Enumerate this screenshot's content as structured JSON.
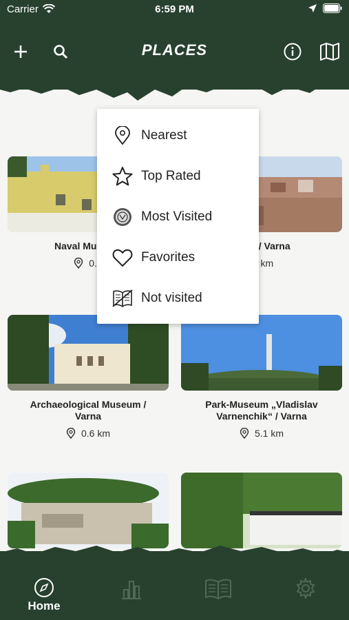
{
  "status": {
    "carrier": "Carrier",
    "time": "6:59 PM"
  },
  "header": {
    "title": "PLACES"
  },
  "places": [
    {
      "name": "Naval Museum",
      "distance": "0.4"
    },
    {
      "name": "rmae / Varna",
      "distance": ".5 km"
    },
    {
      "name": "Archaeological Museum    /\nVarna",
      "distance": "0.6 km"
    },
    {
      "name": "Park-Museum „Vladislav\nVarnenchik“ / Varna",
      "distance": "5.1 km"
    },
    {
      "name": "",
      "distance": ""
    },
    {
      "name": "",
      "distance": ""
    }
  ],
  "menu": {
    "items": [
      {
        "label": "Nearest",
        "icon": "map-pin-icon"
      },
      {
        "label": "Top Rated",
        "icon": "star-icon"
      },
      {
        "label": "Most Visited",
        "icon": "stamp-icon"
      },
      {
        "label": "Favorites",
        "icon": "heart-icon"
      },
      {
        "label": "Not visited",
        "icon": "crossed-book-icon"
      }
    ]
  },
  "tabbar": {
    "home_label": "Home"
  },
  "colors": {
    "primary": "#28412f",
    "background": "#f5f5f3"
  }
}
